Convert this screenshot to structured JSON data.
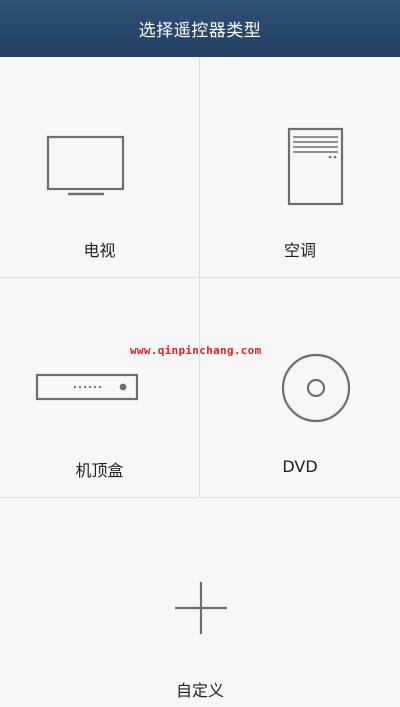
{
  "header": {
    "title": "选择遥控器类型"
  },
  "devices": {
    "tv": {
      "label": "电视",
      "icon": "tv-icon"
    },
    "ac": {
      "label": "空调",
      "icon": "air-conditioner-icon"
    },
    "stb": {
      "label": "机顶盒",
      "icon": "set-top-box-icon"
    },
    "dvd": {
      "label": "DVD",
      "icon": "disc-icon"
    },
    "custom": {
      "label": "自定义",
      "icon": "plus-icon"
    }
  },
  "watermark": "www.qinpinchang.com",
  "colors": {
    "header_bg": "#2a4a6e",
    "page_bg": "#f7f7f7",
    "icon_stroke": "#6e6e6e",
    "divider": "#dedede",
    "watermark": "#e0201e"
  }
}
